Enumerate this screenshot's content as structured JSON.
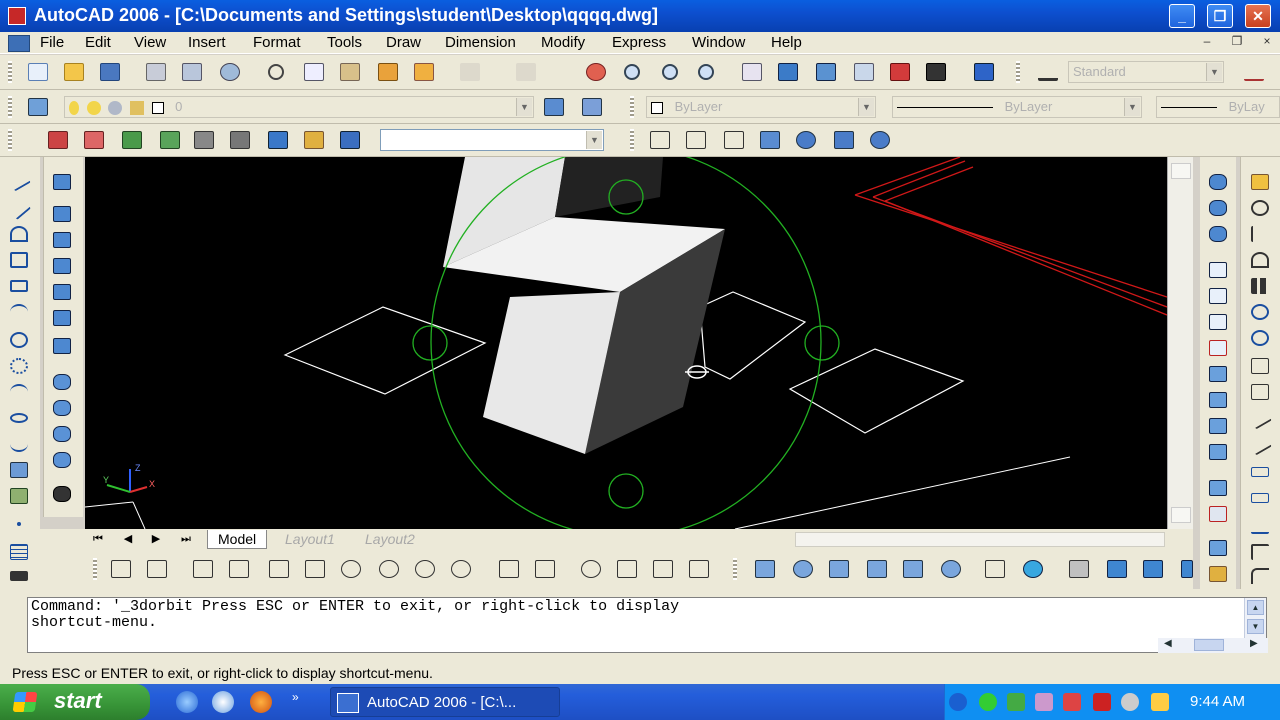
{
  "window": {
    "title": "AutoCAD 2006 - [C:\\Documents and Settings\\student\\Desktop\\qqqq.dwg]",
    "controls": {
      "minimize": "_",
      "maximize": "❐",
      "close": "✕"
    }
  },
  "menubar": {
    "items": [
      "File",
      "Edit",
      "View",
      "Insert",
      "Format",
      "Tools",
      "Draw",
      "Dimension",
      "Modify",
      "Express",
      "Window",
      "Help"
    ],
    "mdi_controls": [
      "–",
      "❐",
      "×"
    ]
  },
  "toolbars": {
    "text_style": "Standard",
    "layer_value": "0",
    "color_value": "ByLayer",
    "linetype_value": "ByLayer",
    "lineweight_value": "ByLay"
  },
  "layout_tabs": {
    "nav": [
      "⏮",
      "◀",
      "▶",
      "⏭"
    ],
    "tabs": [
      "Model",
      "Layout1",
      "Layout2"
    ],
    "active": "Model"
  },
  "command": {
    "line1": "Command: '_3dorbit Press ESC or ENTER to exit, or right-click to display",
    "line2": "shortcut-menu."
  },
  "status": {
    "text": "Press ESC or ENTER to exit, or right-click to display shortcut-menu."
  },
  "taskbar": {
    "start_label": "start",
    "task_label": "AutoCAD 2006 - [C:\\...",
    "clock": "9:44 AM"
  },
  "ucs_icon": {
    "x_label": "X",
    "y_label": "Y",
    "z_label": "Z"
  },
  "colors": {
    "titlebar": "#0d4fcf",
    "viewport_bg": "#000000",
    "orbit_arc": "#22b022",
    "red_lines": "#d01818",
    "start_green": "#379437"
  }
}
